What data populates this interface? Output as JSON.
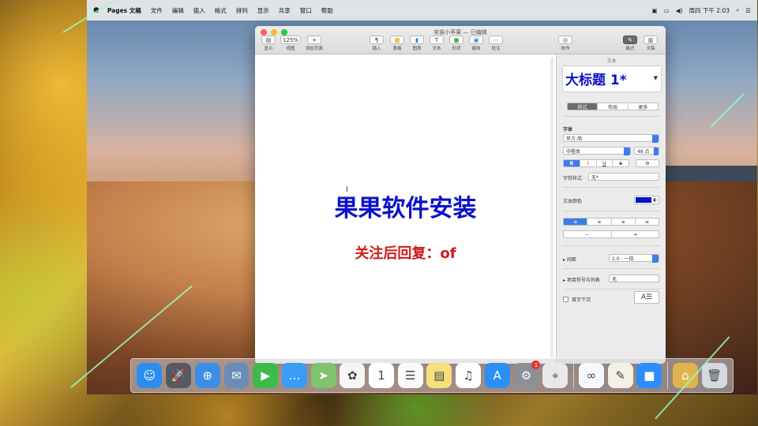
{
  "menubar": {
    "app_name": "Pages 文稿",
    "items": [
      "文件",
      "编辑",
      "插入",
      "格式",
      "排列",
      "显示",
      "共享",
      "窗口",
      "帮助"
    ],
    "clock": "周四 下午 2:03"
  },
  "window": {
    "title": "安装小苹果 — 已编辑",
    "toolbar": [
      {
        "label": "显示",
        "glyph": "▤"
      },
      {
        "label": "视图",
        "glyph": "125%"
      },
      {
        "label": "添加页面",
        "glyph": "+"
      },
      {
        "label": "插入",
        "glyph": "¶"
      },
      {
        "label": "表格",
        "glyph": "▦"
      },
      {
        "label": "图表",
        "glyph": "▮"
      },
      {
        "label": "文本",
        "glyph": "T"
      },
      {
        "label": "形状",
        "glyph": "■"
      },
      {
        "label": "媒体",
        "glyph": "▣"
      },
      {
        "label": "批注",
        "glyph": "▭"
      },
      {
        "label": "协作",
        "glyph": "◎"
      },
      {
        "label": "格式",
        "glyph": "✎"
      },
      {
        "label": "文稿",
        "glyph": "▥"
      }
    ]
  },
  "document": {
    "heading": "果果软件安装",
    "subheading": "关注后回复：of"
  },
  "inspector": {
    "header_small": "文本",
    "style_name": "大标题 1*",
    "tabs": [
      "样式",
      "布局",
      "更多"
    ],
    "font_section": "字体",
    "font_family": "苹方-简",
    "font_weight": "中粗体",
    "font_size": "48 点",
    "bius": [
      "B",
      "I",
      "U",
      "S",
      "⚙"
    ],
    "char_style_label": "字符样式",
    "char_style_value": "无*",
    "text_color_label": "文本颜色",
    "text_color": "#0a12c8",
    "align": [
      "≡",
      "≡",
      "≡",
      "≡"
    ],
    "indent": [
      "⇤",
      "⇥"
    ],
    "spacing_label": "间距",
    "spacing_value": "1.0 - 一倍",
    "bullets_label": "项目符号与列表",
    "bullets_value": "无",
    "dropcap_label": "首字下沉"
  },
  "dock": [
    {
      "name": "finder",
      "color": "#2d8cf0",
      "glyph": "☺"
    },
    {
      "name": "launchpad",
      "color": "#555a66",
      "glyph": "🚀"
    },
    {
      "name": "safari",
      "color": "#3a8ee6",
      "glyph": "⊕"
    },
    {
      "name": "preview",
      "color": "#6b8cb8",
      "glyph": "✉"
    },
    {
      "name": "facetime",
      "color": "#3dbb4a",
      "glyph": "▶"
    },
    {
      "name": "messages",
      "color": "#3b9cf5",
      "glyph": "…"
    },
    {
      "name": "maps",
      "color": "#7fc36e",
      "glyph": "➤"
    },
    {
      "name": "photos",
      "color": "#f6f6f6",
      "glyph": "✿"
    },
    {
      "name": "calendar",
      "color": "#ffffff",
      "glyph": "1"
    },
    {
      "name": "reminders",
      "color": "#fafafa",
      "glyph": "☰"
    },
    {
      "name": "notes",
      "color": "#f7e07a",
      "glyph": "▤"
    },
    {
      "name": "music",
      "color": "#fdfdfd",
      "glyph": "♫"
    },
    {
      "name": "app-store",
      "color": "#2c8ff5",
      "glyph": "A"
    },
    {
      "name": "system-preferences",
      "color": "#8a8f98",
      "glyph": "⚙",
      "badge": "1"
    },
    {
      "name": "screenshot",
      "color": "#e8e8e8",
      "glyph": "⌖"
    },
    {
      "name": "baidu-netdisk",
      "color": "#f4f8ff",
      "glyph": "∞"
    },
    {
      "name": "pages",
      "color": "#f5f0e6",
      "glyph": "✎"
    },
    {
      "name": "zoom",
      "color": "#2d8cff",
      "glyph": "■"
    },
    {
      "name": "archive",
      "color": "#e0b44c",
      "glyph": "⌂"
    },
    {
      "name": "trash",
      "color": "#d5d8dc",
      "glyph": "🗑"
    }
  ]
}
